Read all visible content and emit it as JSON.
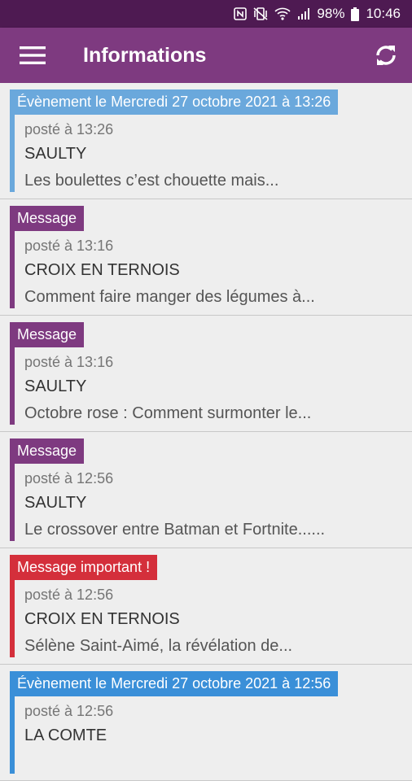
{
  "status_bar": {
    "battery": "98%",
    "time": "10:46",
    "icons": [
      "nfc-icon",
      "vibrate-icon",
      "wifi-icon",
      "signal-icon",
      "battery-icon"
    ]
  },
  "app_bar": {
    "title": "Informations",
    "menu_icon": "menu-icon",
    "refresh_icon": "refresh-icon",
    "color": "#7e3a80"
  },
  "colors": {
    "event": "#6aa8dc",
    "event_strong": "#3a8fd8",
    "message": "#7e3a80",
    "important": "#d42f3b"
  },
  "items": [
    {
      "tag": "Évènement le Mercredi 27 octobre 2021 à 13:26",
      "posted": "posté à 13:26",
      "place": "SAULTY",
      "excerpt": "Les boulettes c’est chouette mais...",
      "color": "#6aa8dc"
    },
    {
      "tag": "Message",
      "posted": "posté à 13:16",
      "place": "CROIX EN TERNOIS",
      "excerpt": "Comment faire manger des légumes à...",
      "color": "#7e3a80"
    },
    {
      "tag": "Message",
      "posted": "posté à 13:16",
      "place": "SAULTY",
      "excerpt": "Octobre rose : Comment surmonter le...",
      "color": "#7e3a80"
    },
    {
      "tag": "Message",
      "posted": "posté à 12:56",
      "place": "SAULTY",
      "excerpt": "Le crossover entre Batman et Fortnite......",
      "color": "#7e3a80"
    },
    {
      "tag": "Message important !",
      "posted": "posté à 12:56",
      "place": "CROIX EN TERNOIS",
      "excerpt": "Sélène Saint-Aimé, la révélation de...",
      "color": "#d42f3b"
    },
    {
      "tag": "Évènement le Mercredi 27 octobre 2021 à 12:56",
      "posted": "posté à 12:56",
      "place": "LA COMTE",
      "excerpt": "",
      "color": "#3a8fd8"
    }
  ]
}
